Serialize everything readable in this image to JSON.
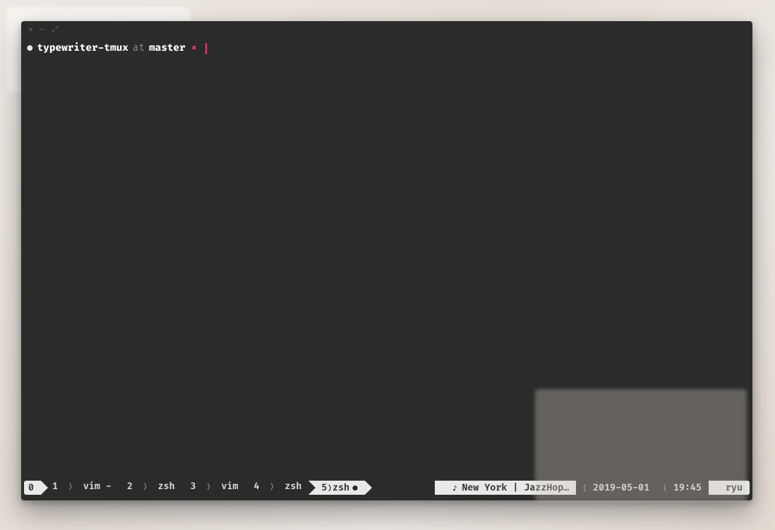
{
  "titlebar": {
    "close_glyph": "✕",
    "minimize_glyph": "—",
    "maximize_glyph": "⤢"
  },
  "prompt": {
    "bullet": "●",
    "cwd": "typewriter-tmux",
    "at": "at",
    "branch": "master",
    "dirty_mark": "×"
  },
  "status": {
    "session": "0",
    "windows": [
      {
        "index": "1",
        "name": "vim -",
        "active": false
      },
      {
        "index": "2",
        "name": "zsh",
        "active": false
      },
      {
        "index": "3",
        "name": "vim",
        "active": false
      },
      {
        "index": "4",
        "name": "zsh",
        "active": false
      },
      {
        "index": "5",
        "name": "zsh",
        "active": true,
        "flag": "●"
      }
    ],
    "right": {
      "music_icon": "♪",
      "music": "New York | JazzHop…",
      "date": "2019-05-01",
      "time": "19:45",
      "user": "ryu"
    },
    "chevron_right": "❭",
    "chevron_left": "❬"
  }
}
